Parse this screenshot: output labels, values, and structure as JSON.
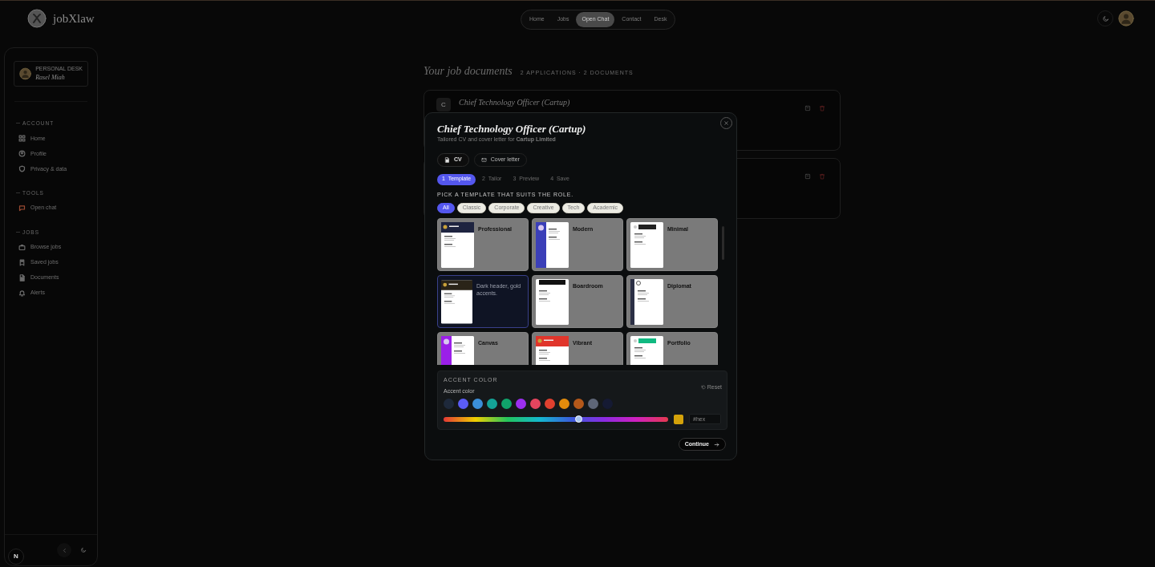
{
  "brand": {
    "name": "jobXlaw"
  },
  "nav": [
    {
      "label": "Home",
      "selected": false
    },
    {
      "label": "Jobs",
      "selected": false
    },
    {
      "label": "Open Chat",
      "selected": true
    },
    {
      "label": "Contact",
      "selected": false
    },
    {
      "label": "Desk",
      "selected": false
    }
  ],
  "sidebar": {
    "profile": {
      "caption": "PERSONAL DESK",
      "name": "Rasel Miah"
    },
    "sections": [
      {
        "heading": "ACCOUNT",
        "items": [
          {
            "label": "Home",
            "kind": "grid",
            "color": "#6b6b6b"
          },
          {
            "label": "Profile",
            "kind": "user",
            "color": "#6b6b6b"
          },
          {
            "label": "Privacy & data",
            "kind": "shield",
            "color": "#6b6b6b"
          }
        ]
      },
      {
        "heading": "TOOLS",
        "items": [
          {
            "label": "Open chat",
            "kind": "chat",
            "color": "#9a4a32"
          }
        ]
      },
      {
        "heading": "JOBS",
        "items": [
          {
            "label": "Browse jobs",
            "kind": "briefcase",
            "color": "#6b6b6b"
          },
          {
            "label": "Saved jobs",
            "kind": "bookmark",
            "color": "#6b6b6b"
          },
          {
            "label": "Documents",
            "kind": "file",
            "color": "#6b6b6b"
          },
          {
            "label": "Alerts",
            "kind": "bell",
            "color": "#6b6b6b"
          }
        ]
      }
    ]
  },
  "dev_badge": "N",
  "page": {
    "title": "Your job documents",
    "summary": "2 APPLICATIONS · 2 DOCUMENTS",
    "documents": [
      {
        "kind": "visible",
        "badge": "C",
        "title": "Chief Technology Officer (Cartup)"
      },
      {
        "kind": "covered"
      }
    ]
  },
  "modal": {
    "title": "Chief Technology Officer (Cartup)",
    "subtitle": "Tailored CV and cover letter for **Cartup Limited**",
    "doc_tabs": [
      {
        "label": "CV",
        "kind": "file",
        "selected": true
      },
      {
        "label": "Cover letter",
        "kind": "mail",
        "selected": false
      }
    ],
    "steps": [
      {
        "label": "1  Template",
        "selected": true
      },
      {
        "label": "2  Tailor",
        "selected": false
      },
      {
        "label": "3  Preview",
        "selected": false
      },
      {
        "label": "4  Save",
        "selected": false
      }
    ],
    "prompt": "PICK A TEMPLATE THAT SUITS THE ROLE.",
    "filters": [
      {
        "label": "All",
        "selected": true
      },
      {
        "label": "Classic",
        "selected": false
      },
      {
        "label": "Corporate",
        "selected": false
      },
      {
        "label": "Creative",
        "selected": false
      },
      {
        "label": "Tech",
        "selected": false
      },
      {
        "label": "Academic",
        "selected": false
      }
    ],
    "templates": [
      {
        "name": "Professional",
        "kind": "header",
        "color": "#1e2440",
        "selected": false
      },
      {
        "name": "Modern",
        "kind": "sidebar",
        "color": "#3b3fb8",
        "selected": false
      },
      {
        "name": "Minimal",
        "kind": "plain",
        "color": "#222222",
        "selected": false
      },
      {
        "description": "Dark header, gold accents.",
        "kind": "header",
        "color": "#2a2418",
        "selected": true
      },
      {
        "name": "Boardroom",
        "kind": "rule",
        "color": "#111111",
        "selected": false
      },
      {
        "name": "Diplomat",
        "kind": "leftrule",
        "color": "#2b2f45",
        "selected": false
      },
      {
        "name": "Canvas",
        "kind": "sidebar",
        "color": "#9b1fe8",
        "selected": false
      },
      {
        "name": "Vibrant",
        "kind": "header",
        "color": "#e0352b",
        "selected": false
      },
      {
        "name": "Portfolio",
        "kind": "plain",
        "color": "#10b981",
        "selected": false
      }
    ],
    "accent": {
      "heading": "ACCENT COLOR",
      "label": "Accent color",
      "reset": "Reset",
      "swatches": [
        {
          "color": "#1e293b"
        },
        {
          "color": "#5b5cf6"
        },
        {
          "color": "#3b8fd9"
        },
        {
          "color": "#14a397"
        },
        {
          "color": "#10a36a"
        },
        {
          "color": "#9b2ff0"
        },
        {
          "color": "#e5455e"
        },
        {
          "color": "#e0402f"
        },
        {
          "color": "#e38c0c"
        },
        {
          "color": "#b4581a"
        },
        {
          "color": "#5e6678"
        },
        {
          "color": "#151a33"
        }
      ],
      "hue": {
        "level": 0.6
      },
      "preview": {
        "color": "#d4a20a"
      },
      "hex_placeholder": "#hex"
    },
    "continue": "Continue"
  }
}
